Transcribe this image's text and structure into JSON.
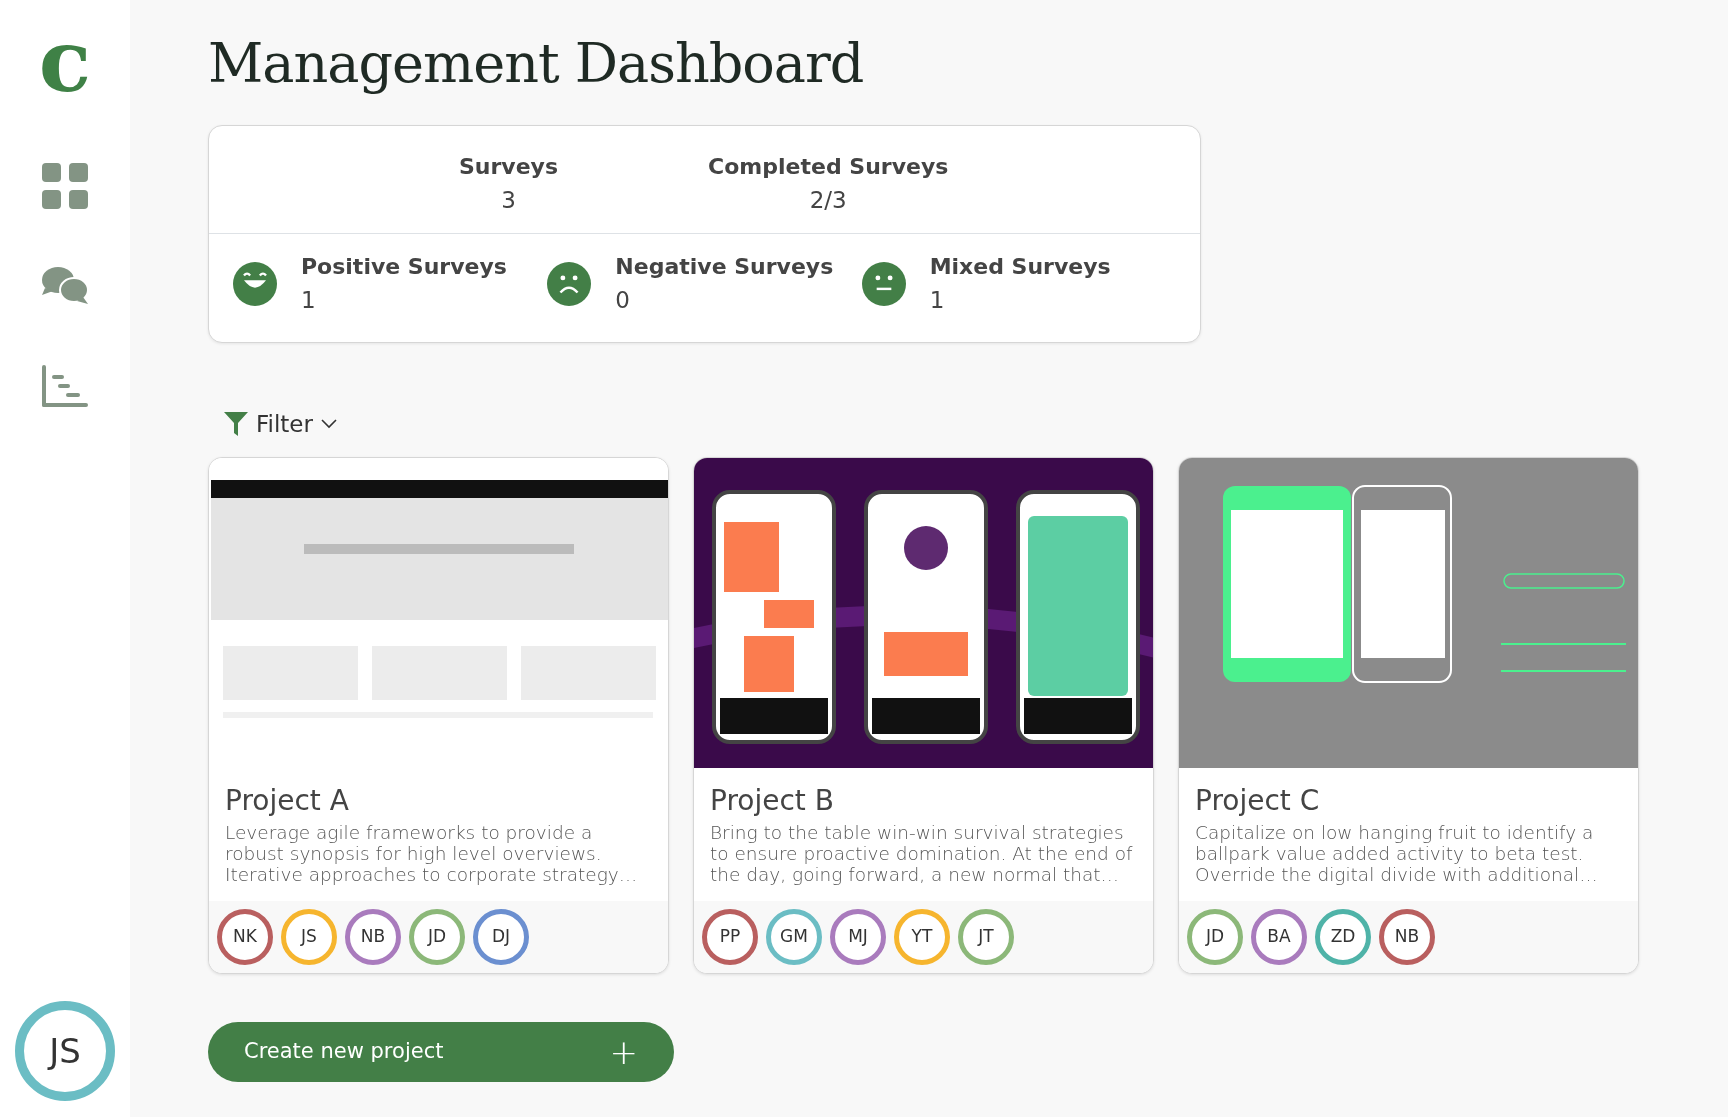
{
  "sidebar": {
    "logo": "c",
    "items": [
      {
        "kind": "dashboard",
        "selected": false
      },
      {
        "kind": "chat",
        "selected": false
      },
      {
        "kind": "chart",
        "selected": false
      }
    ],
    "user": {
      "initials": "JS",
      "color": "#6bbdc4"
    }
  },
  "title": "Management Dashboard",
  "summary": {
    "totals": [
      {
        "label": "Surveys",
        "value": "3"
      },
      {
        "label": "Completed Surveys",
        "value": "2/3"
      }
    ],
    "sentiments": [
      {
        "kind": "positive",
        "label": "Positive Surveys",
        "value": "1"
      },
      {
        "kind": "negative",
        "label": "Negative Surveys",
        "value": "0"
      },
      {
        "kind": "mixed",
        "label": "Mixed Surveys",
        "value": "1"
      }
    ]
  },
  "filter": {
    "label": "Filter"
  },
  "projects": [
    {
      "name": "Project A",
      "description": "Leverage agile frameworks to provide a robust synopsis for high level overviews. Iterative approaches to corporate strategy…",
      "image": {
        "kind": "picture"
      },
      "members": [
        {
          "initials": "NK",
          "color": "#b95f5f"
        },
        {
          "initials": "JS",
          "color": "#f6b52e"
        },
        {
          "initials": "NB",
          "color": "#a97bbd"
        },
        {
          "initials": "JD",
          "color": "#8cb879"
        },
        {
          "initials": "DJ",
          "color": "#6b8fd0"
        }
      ]
    },
    {
      "name": "Project B",
      "description": "Bring to the table win-win survival strategies to ensure proactive domination. At the end of the day, going forward, a new normal that…",
      "image": {
        "kind": "picture"
      },
      "members": [
        {
          "initials": "PP",
          "color": "#b95f5f"
        },
        {
          "initials": "GM",
          "color": "#6bbdc4"
        },
        {
          "initials": "MJ",
          "color": "#a97bbd"
        },
        {
          "initials": "YT",
          "color": "#f6b52e"
        },
        {
          "initials": "JT",
          "color": "#8cb879"
        }
      ]
    },
    {
      "name": "Project C",
      "description": "Capitalize on low hanging fruit to identify a ballpark value added activity to beta test. Override the digital divide with additional…",
      "image": {
        "kind": "picture"
      },
      "members": [
        {
          "initials": "JD",
          "color": "#8cb879"
        },
        {
          "initials": "BA",
          "color": "#a97bbd"
        },
        {
          "initials": "ZD",
          "color": "#4fb3a8"
        },
        {
          "initials": "NB",
          "color": "#b95f5f"
        }
      ]
    }
  ],
  "create_button": {
    "label": "Create new project",
    "icon": "+"
  }
}
